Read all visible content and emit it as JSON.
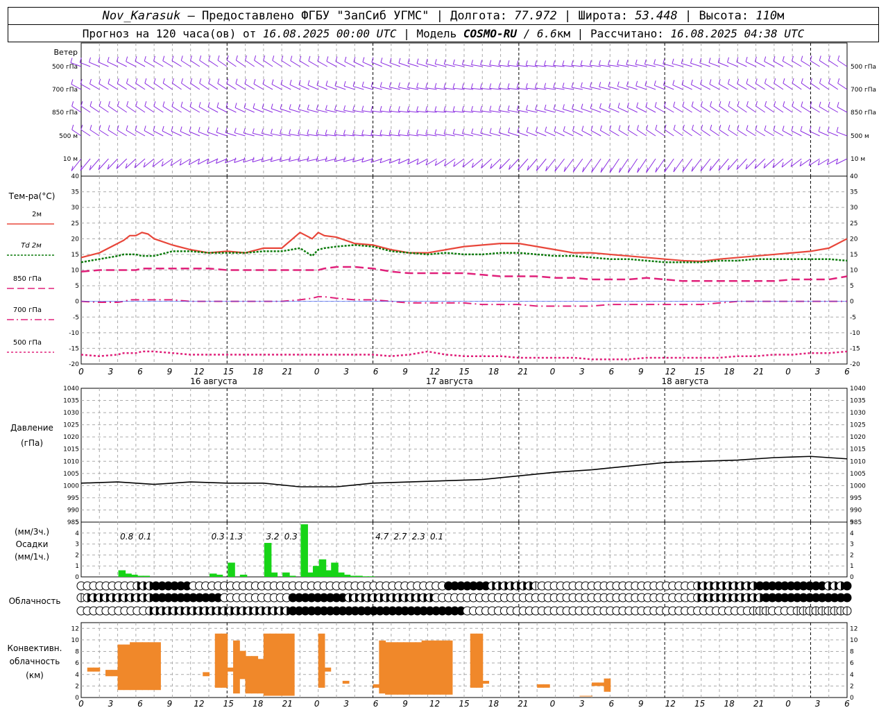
{
  "header": {
    "station": "Nov_Karasuk",
    "provider": "– Предоставлено ФГБУ \"ЗапСиб УГМС\" | Долгота:",
    "lon": "77.972",
    "lat_label": "| Широта:",
    "lat": "53.448",
    "alt_label": "| Высота:",
    "alt": "110",
    "alt_unit": "м",
    "line2_a": "Прогноз на 120 часа(ов) от",
    "init_time": "16.08.2025 00:00 UTC",
    "line2_b": "| Модель",
    "model": "COSMO-RU",
    "res": "/ 6.6",
    "res_unit": "км",
    "line2_c": "| Рассчитано:",
    "calc_time": "16.08.2025 04:38 UTC"
  },
  "labels": {
    "wind_title": "Ветер",
    "wind_levels": [
      "500 гПа",
      "700 гПа",
      "850 гПа",
      "500 м",
      "10 м"
    ],
    "temp_title": "Тем-ра(°С)",
    "temp_legend": [
      "2м",
      "Td 2м",
      "850 гПа",
      "700 гПа",
      "500 гПа"
    ],
    "pres_title_1": "Давление",
    "pres_title_2": "(гПа)",
    "prec_title_1": "(мм/3ч.)",
    "prec_title_2": "Осадки",
    "prec_title_3": "(мм/1ч.)",
    "cloud_title": "Облачность",
    "conv_title_1": "Конвективн.",
    "conv_title_2": "облачность",
    "conv_title_3": "(км)"
  },
  "x_axis": {
    "hour_labels": [
      "0",
      "3",
      "6",
      "9",
      "12",
      "15",
      "18",
      "21",
      "0",
      "3",
      "6",
      "9",
      "12",
      "15",
      "18",
      "21",
      "0",
      "3",
      "6",
      "9",
      "12",
      "15",
      "18",
      "21",
      "0",
      "3",
      "6"
    ],
    "day_labels": [
      "16 августа",
      "17 августа",
      "18 августа"
    ]
  },
  "colors": {
    "t2m": "#e8463a",
    "td": "#0a7a0a",
    "t850": "#e0207a",
    "t700": "#e0207a",
    "t500": "#e0207a",
    "wind": "#8a2be2",
    "pressure": "#000000",
    "precip": "#17d417",
    "conv": "#f0882a"
  },
  "chart_data": [
    {
      "type": "line",
      "title": "Ветер",
      "levels": [
        "500 гПа",
        "700 гПа",
        "850 гПа",
        "500 м",
        "10 м"
      ],
      "x_hours": "0-126 hourly"
    },
    {
      "type": "line",
      "title": "Тем-ра(°С)",
      "ylim": [
        -20,
        40
      ],
      "x": [
        0,
        3,
        6,
        7,
        8,
        9,
        10,
        11,
        12,
        15,
        18,
        21,
        24,
        27,
        30,
        33,
        36,
        38,
        39,
        40,
        42,
        45,
        48,
        51,
        54,
        57,
        60,
        63,
        66,
        69,
        72,
        75,
        78,
        81,
        84,
        87,
        90,
        93,
        96,
        99,
        102,
        105,
        108,
        111,
        114,
        117,
        120,
        123,
        126
      ],
      "series": [
        {
          "name": "2м",
          "values": [
            14,
            15.5,
            18.5,
            19.5,
            21,
            21,
            22,
            21.5,
            20,
            18,
            16.5,
            15.5,
            16,
            15.5,
            17,
            17,
            22,
            20,
            22,
            21,
            20.5,
            18.5,
            18,
            16.5,
            15.5,
            15.5,
            16.5,
            17.5,
            18,
            18.5,
            18.5,
            17.5,
            16.5,
            15.5,
            15.5,
            15,
            14.5,
            14,
            13.5,
            13,
            12.8,
            13.5,
            14,
            14.5,
            15,
            15.5,
            16,
            17,
            20
          ]
        },
        {
          "name": "Td 2м",
          "values": [
            12.5,
            13.5,
            14.5,
            15,
            15,
            15,
            14.5,
            14.5,
            14.5,
            16,
            16,
            15.5,
            15.5,
            15.5,
            16,
            16,
            17,
            14.5,
            16.5,
            17,
            17.5,
            18,
            17.5,
            16,
            15.5,
            15,
            15.5,
            15,
            15,
            15.5,
            15.5,
            15,
            14.5,
            14.5,
            14,
            13.5,
            13.5,
            13,
            12.5,
            12.5,
            12.5,
            13,
            13,
            13.5,
            13.5,
            13.5,
            13.5,
            13.5,
            13
          ]
        },
        {
          "name": "850 гПа",
          "values": [
            9.5,
            10,
            10,
            10,
            10,
            10,
            10.5,
            10.5,
            10.5,
            10.5,
            10.5,
            10.5,
            10,
            10,
            10,
            10,
            10,
            10,
            10,
            10.5,
            11,
            11,
            10.5,
            9.5,
            9,
            9,
            9,
            9,
            8.5,
            8,
            8,
            8,
            7.5,
            7.5,
            7,
            7,
            7,
            7.5,
            7,
            6.5,
            6.5,
            6.5,
            6.5,
            6.5,
            6.5,
            7,
            7,
            7,
            8
          ]
        },
        {
          "name": "700 гПа",
          "values": [
            0,
            -0.3,
            -0.3,
            0,
            0.5,
            0.5,
            0.5,
            0.5,
            0.5,
            0.5,
            0,
            0,
            0,
            0,
            0,
            0,
            0.5,
            1,
            1.5,
            1.5,
            1,
            0.5,
            0.5,
            0,
            -0.5,
            -0.5,
            -0.5,
            -0.5,
            -1,
            -1,
            -1,
            -1.5,
            -1.5,
            -1.5,
            -1.5,
            -1,
            -1,
            -1,
            -1,
            -1,
            -1,
            -0.5,
            0,
            0,
            0,
            0,
            0,
            0,
            0
          ]
        },
        {
          "name": "500 гПа",
          "values": [
            -17,
            -17.5,
            -17,
            -16.5,
            -16.5,
            -16.5,
            -16,
            -16,
            -16,
            -16.5,
            -17,
            -17,
            -17,
            -17,
            -17,
            -17,
            -17,
            -17,
            -17,
            -17,
            -17,
            -17,
            -17,
            -17.5,
            -17,
            -16,
            -17,
            -17.5,
            -17.5,
            -17.5,
            -18,
            -18,
            -18,
            -18,
            -18.5,
            -18.5,
            -18.5,
            -18,
            -18,
            -18,
            -18,
            -18,
            -17.5,
            -17.5,
            -17,
            -17,
            -16.5,
            -16.5,
            -16
          ]
        }
      ]
    },
    {
      "type": "line",
      "title": "Давление",
      "ylabel": "(гПа)",
      "ylim": [
        985,
        1040
      ],
      "x": [
        0,
        6,
        12,
        18,
        24,
        30,
        36,
        42,
        48,
        54,
        60,
        66,
        72,
        78,
        84,
        90,
        96,
        102,
        108,
        114,
        120,
        126
      ],
      "values": [
        1001,
        1001.5,
        1000.5,
        1001.5,
        1001,
        1001,
        999.5,
        999.5,
        1001,
        1001.5,
        1002,
        1002.5,
        1004,
        1005.5,
        1006.5,
        1008,
        1009.5,
        1010,
        1010.5,
        1011.5,
        1012,
        1011
      ]
    },
    {
      "type": "bar",
      "title": "Осадки",
      "ylim": [
        0,
        5
      ],
      "x_bar": [
        6,
        7,
        8,
        9,
        10,
        21,
        22,
        24,
        26,
        30,
        31,
        33,
        34,
        36,
        37,
        38,
        39,
        40,
        41,
        42,
        43,
        44,
        45,
        46,
        47
      ],
      "values": [
        0.6,
        0.3,
        0.2,
        0.1,
        0.1,
        0.3,
        0.2,
        1.3,
        0.2,
        3.1,
        0.4,
        0.4,
        0.1,
        4.8,
        0.4,
        1.0,
        1.6,
        0.6,
        1.3,
        0.4,
        0.2,
        0.1,
        0.1,
        0.05,
        0.05
      ],
      "labels_3h": [
        {
          "x": 7.5,
          "text": "0.8"
        },
        {
          "x": 10.5,
          "text": "0.1"
        },
        {
          "x": 22.5,
          "text": "0.3"
        },
        {
          "x": 25.5,
          "text": "1.3"
        },
        {
          "x": 31.5,
          "text": "3.2"
        },
        {
          "x": 34.5,
          "text": "0.3"
        },
        {
          "x": 49.5,
          "text": "4.7"
        },
        {
          "x": 52.5,
          "text": "2.7"
        },
        {
          "x": 55.5,
          "text": "2.3"
        },
        {
          "x": 58.5,
          "text": "0.1"
        }
      ]
    },
    {
      "type": "table",
      "title": "Облачность",
      "rows_hourly_0_to_8": [
        "1111111113334444441111111111111111111111111111111111111111144444443333333211111111111111111111111113333333333444444444443334",
        "2333333333334444444444411111111111444444444333333333333331111111111111111111111111111111111111111113333333333344444444444444",
        "1111111111133333333333333333333333444444444444444444444444444411111111111111111111111111111111111111111111112221111222222222"
      ]
    },
    {
      "type": "bar",
      "title": "Конвективн. облачность",
      "ylabel": "(км)",
      "ylim": [
        0,
        12
      ],
      "x_bar": [
        1,
        2,
        4,
        5,
        6,
        7,
        8,
        9,
        10,
        11,
        12,
        20,
        22,
        23,
        24,
        25,
        26,
        27,
        28,
        29,
        30,
        31,
        32,
        33,
        34,
        39,
        40,
        43,
        48,
        49,
        50,
        51,
        52,
        53,
        54,
        55,
        56,
        57,
        58,
        59,
        60,
        64,
        65,
        66,
        75,
        76,
        82,
        83,
        84,
        85,
        86
      ],
      "bottom": [
        4.5,
        4.5,
        3.7,
        3.7,
        1.3,
        1.3,
        1.3,
        1.3,
        1.3,
        1.3,
        1.3,
        3.7,
        1.7,
        1.7,
        4.5,
        0.7,
        3.2,
        0.7,
        0.7,
        0.7,
        0.3,
        0.3,
        0.3,
        0.3,
        0.3,
        1.7,
        4.5,
        2.4,
        1.7,
        0.7,
        0.5,
        0.5,
        0.5,
        0.5,
        0.5,
        0.5,
        0.5,
        0.5,
        0.5,
        0.5,
        0.5,
        1.7,
        1.7,
        2.4,
        1.7,
        1.7,
        0.2,
        0.2,
        2.0,
        2.0,
        1.0
      ],
      "top": [
        5.2,
        5.2,
        4.8,
        4.8,
        9.2,
        9.2,
        9.6,
        9.6,
        9.6,
        9.6,
        9.6,
        4.4,
        11.1,
        11.1,
        5.2,
        9.9,
        8.1,
        7.2,
        7.2,
        6.7,
        11.1,
        11.1,
        11.1,
        11.1,
        11.1,
        11.1,
        5.2,
        2.9,
        2.3,
        9.9,
        9.6,
        9.6,
        9.6,
        9.6,
        9.6,
        9.6,
        9.9,
        9.9,
        9.9,
        9.9,
        9.9,
        11.1,
        11.1,
        2.9,
        2.3,
        2.3,
        0.3,
        0.3,
        2.6,
        2.6,
        3.3
      ]
    }
  ]
}
